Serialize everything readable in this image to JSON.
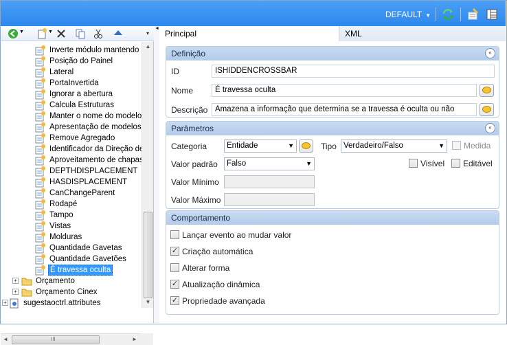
{
  "topbar": {
    "profile_label": "DEFAULT",
    "profile_arrow": "▼",
    "icons": [
      "refresh-icon",
      "settings-icon",
      "layout-icon"
    ],
    "color": "#2d88ee"
  },
  "left_toolbar": {
    "icons": [
      "back-icon",
      "new-item-icon",
      "delete-icon",
      "copy-icon",
      "cut-icon",
      "move-up-icon",
      "overflow-icon"
    ]
  },
  "tree": {
    "items": [
      "Inverte módulo mantendo d",
      "Posição do Painel",
      "Lateral",
      "PortaInvertida",
      "Ignorar a abertura",
      "Calcula Estruturas",
      "Manter o nome do modelo",
      "Apresentação de modelos r",
      "Remove Agregado",
      "Identificador da Direção de",
      "Aproveitamento de chapas",
      "DEPTHDISPLACEMENT",
      "HASDISPLACEMENT",
      "CanChangeParent",
      "Rodapé",
      "Tampo",
      "Vistas",
      "Molduras",
      "Quantidade Gavetas",
      "Quantidade Gavetões",
      "É travessa oculta"
    ],
    "selected_index": 20,
    "folders": [
      "Orçamento",
      "Orçamento Cinex"
    ],
    "root": "sugestaoctrl.attributes",
    "expander_plus": "+",
    "hscroll_grip": "III"
  },
  "tabs": [
    {
      "label": "Principal",
      "active": true
    },
    {
      "label": "XML",
      "active": false
    }
  ],
  "definicao": {
    "title": "Definição",
    "collapse_glyph": "«",
    "id_label": "ID",
    "id_value": "ISHIDDENCROSSBAR",
    "nome_label": "Nome",
    "nome_value": "É travessa oculta",
    "descricao_label": "Descrição",
    "descricao_value": "Amazena a informação que determina se a travessa é oculta ou não"
  },
  "parametros": {
    "title": "Parâmetros",
    "collapse_glyph": "«",
    "categoria_label": "Categoria",
    "categoria_value": "Entidade",
    "tipo_label": "Tipo",
    "tipo_value": "Verdadeiro/Falso",
    "medida_label": "Medida",
    "valor_padrao_label": "Valor padrão",
    "valor_padrao_value": "Falso",
    "visivel_label": "Visível",
    "editavel_label": "Editável",
    "valor_minimo_label": "Valor Mínimo",
    "valor_maximo_label": "Valor Máximo",
    "dropdown_glyph": "▼"
  },
  "comportamento": {
    "title": "Comportamento",
    "checkmark": "✓",
    "items": [
      {
        "label": "Lançar evento ao mudar valor",
        "checked": false
      },
      {
        "label": "Criação automática",
        "checked": true
      },
      {
        "label": "Alterar forma",
        "checked": false
      },
      {
        "label": "Atualização dinâmica",
        "checked": true
      },
      {
        "label": "Propriedade avançada",
        "checked": true
      }
    ]
  }
}
